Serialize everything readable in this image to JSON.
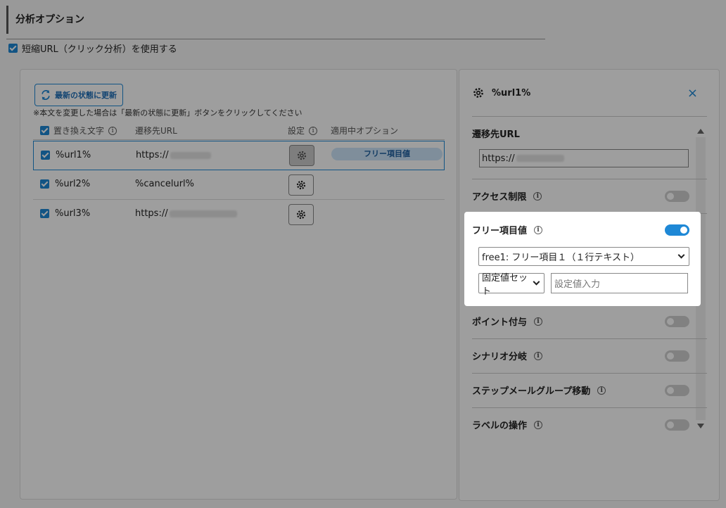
{
  "section": {
    "title": "分析オプション",
    "short_url_label": "短縮URL（クリック分析）を使用する"
  },
  "left": {
    "refresh_button": "最新の状態に更新",
    "note": "※本文を変更した場合は「最新の状態に更新」ボタンをクリックしてください",
    "headers": {
      "replace": "置き換え文字",
      "dest": "遷移先URL",
      "settings": "設定",
      "applied": "適用中オプション"
    },
    "rows": [
      {
        "token": "%url1%",
        "url": "https://",
        "tag": "フリー項目値"
      },
      {
        "token": "%url2%",
        "url": "%cancelurl%",
        "tag": ""
      },
      {
        "token": "%url3%",
        "url": "https://",
        "tag": ""
      }
    ]
  },
  "right": {
    "title": "%url1%",
    "close": "×",
    "dest_label": "遷移先URL",
    "dest_value": "https://",
    "access_label": "アクセス制限",
    "free_label": "フリー項目値",
    "free_select": "free1: フリー項目１（１行テキスト）",
    "fixed_select": "固定値セット",
    "value_placeholder": "設定値入力",
    "point_label": "ポイント付与",
    "scenario_label": "シナリオ分岐",
    "stepmail_label": "ステップメールグループ移動",
    "label_label": "ラベルの操作"
  },
  "icons": {
    "info": "i"
  },
  "colors": {
    "accent": "#1e88d6",
    "tag_bg": "#cde6fa"
  }
}
